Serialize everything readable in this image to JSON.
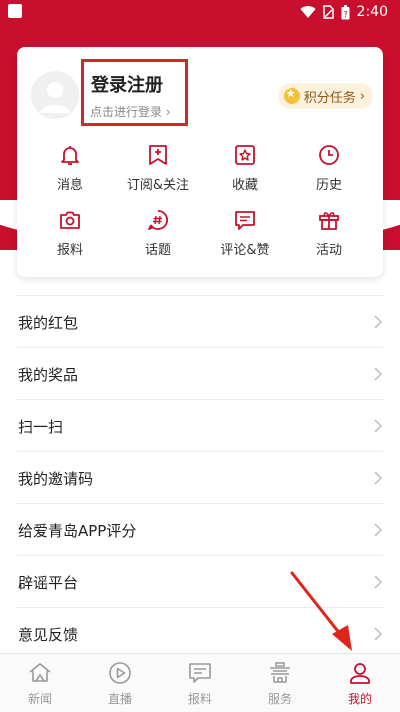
{
  "status_bar": {
    "time": "2:40",
    "icons": [
      "app-icon",
      "wifi-icon",
      "sim-icon",
      "battery-icon"
    ]
  },
  "colors": {
    "brand_red": "#c8102e",
    "highlight_box": "#d3272a"
  },
  "profile": {
    "title": "登录注册",
    "subtitle": "点击进行登录",
    "points_task": "积分任务"
  },
  "quick_actions": [
    {
      "label": "消息",
      "icon": "bell-icon"
    },
    {
      "label": "订阅&关注",
      "icon": "subscribe-icon"
    },
    {
      "label": "收藏",
      "icon": "star-icon"
    },
    {
      "label": "历史",
      "icon": "clock-icon"
    },
    {
      "label": "报料",
      "icon": "camera-icon"
    },
    {
      "label": "话题",
      "icon": "hashtag-icon"
    },
    {
      "label": "评论&赞",
      "icon": "comment-icon"
    },
    {
      "label": "活动",
      "icon": "gift-icon"
    }
  ],
  "menu": [
    {
      "label": "我的红包"
    },
    {
      "label": "我的奖品"
    },
    {
      "label": "扫一扫"
    },
    {
      "label": "我的邀请码"
    },
    {
      "label": "给爱青岛APP评分"
    },
    {
      "label": "辟谣平台"
    },
    {
      "label": "意见反馈"
    }
  ],
  "tabs": [
    {
      "label": "新闻",
      "icon": "news-icon",
      "active": false
    },
    {
      "label": "直播",
      "icon": "play-icon",
      "active": false
    },
    {
      "label": "报料",
      "icon": "report-icon",
      "active": false
    },
    {
      "label": "服务",
      "icon": "service-icon",
      "active": false
    },
    {
      "label": "我的",
      "icon": "user-icon",
      "active": true
    }
  ]
}
